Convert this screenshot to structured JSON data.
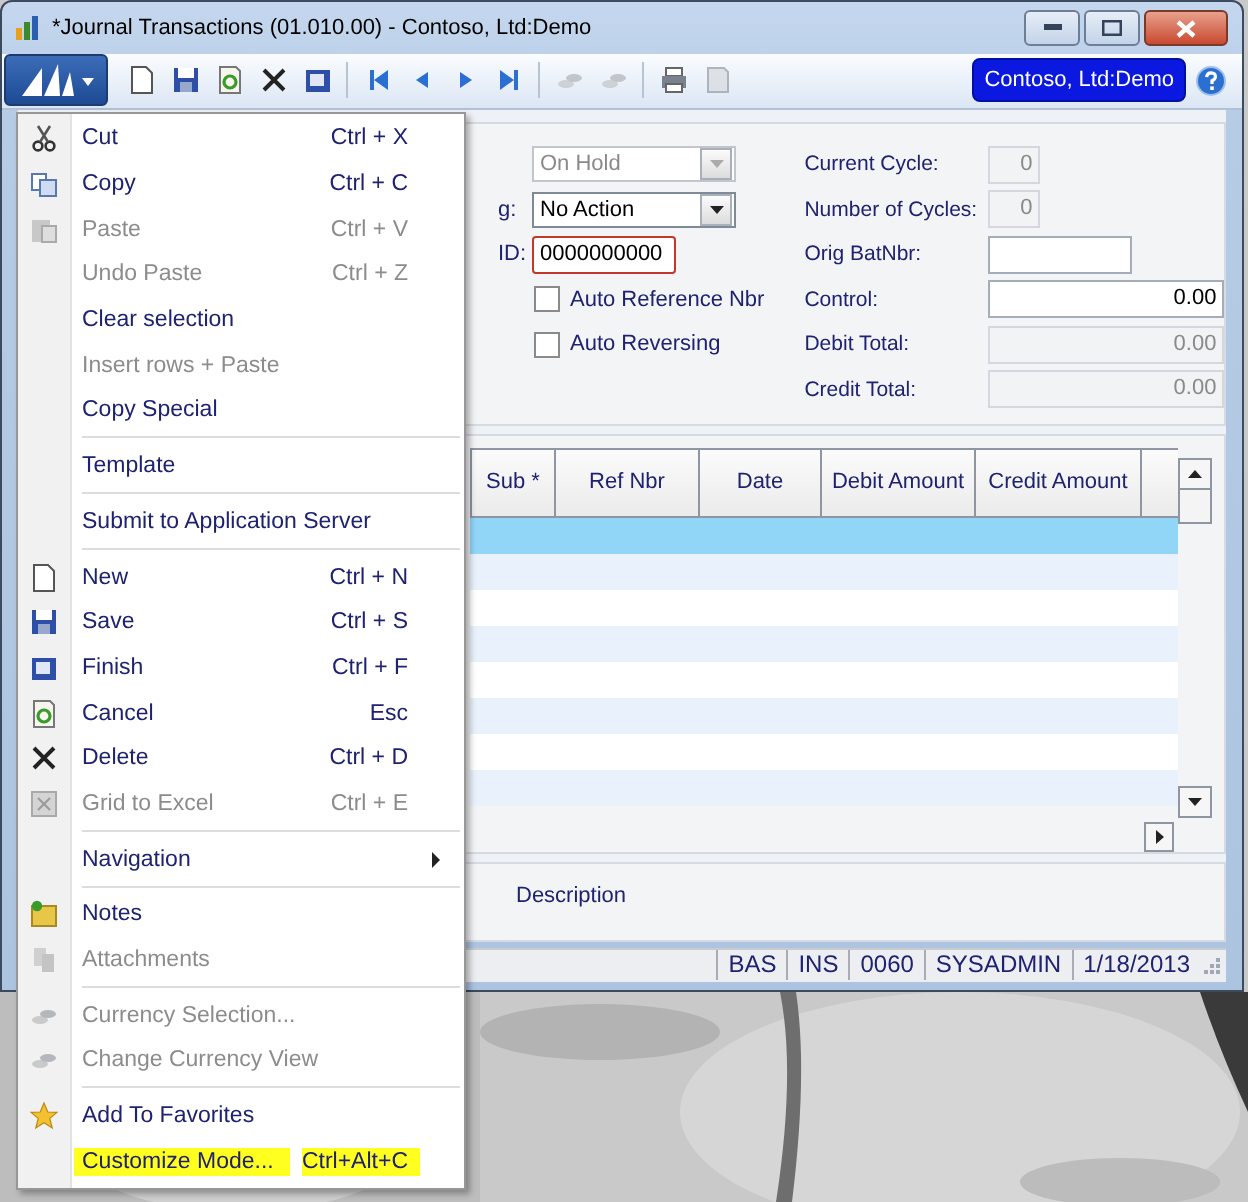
{
  "window": {
    "title": "*Journal Transactions (01.010.00) - Contoso, Ltd:Demo"
  },
  "toolbar": {
    "buttons": [
      {
        "disabled": false
      },
      {
        "disabled": false
      },
      {
        "disabled": false
      },
      {
        "disabled": false
      },
      {
        "disabled": false
      },
      {
        "disabled": false
      },
      {
        "disabled": false
      },
      {
        "disabled": false
      },
      {
        "disabled": false
      },
      {
        "disabled": true
      },
      {
        "disabled": true
      },
      {
        "disabled": false
      },
      {
        "disabled": true
      }
    ],
    "company": "Contoso, Ltd:Demo"
  },
  "form": {
    "left": [
      {
        "kind": "select",
        "value": "On Hold",
        "disabled": true
      },
      {
        "kind": "select",
        "label": "g:",
        "value": "No Action",
        "disabled": false
      },
      {
        "kind": "text",
        "label": "ID:",
        "value": "0000000000",
        "error": true
      },
      {
        "kind": "checkbox",
        "label": "Auto Reference Nbr",
        "checked": false
      },
      {
        "kind": "checkbox",
        "label": "Auto Reversing",
        "checked": false
      }
    ],
    "right": [
      {
        "kind": "short",
        "label": "Current Cycle:",
        "value": "0",
        "disabled": true
      },
      {
        "kind": "short",
        "label": "Number of Cycles:",
        "value": "0",
        "disabled": true
      },
      {
        "kind": "medium",
        "label": "Orig BatNbr:",
        "disabled": false
      },
      {
        "kind": "long",
        "label": "Control:",
        "value": "0.00",
        "disabled": false
      },
      {
        "kind": "long",
        "label": "Debit Total:",
        "value": "0.00",
        "disabled": true
      },
      {
        "kind": "long",
        "label": "Credit Total:",
        "value": "0.00",
        "disabled": true
      }
    ]
  },
  "table": {
    "columns": [
      "Sub *",
      "Ref Nbr",
      "Date",
      "Debit Amount",
      "Credit Amount"
    ],
    "rows": [
      {
        "selected": true
      },
      {
        "selected": false
      },
      {
        "selected": false
      },
      {
        "selected": false
      },
      {
        "selected": false
      },
      {
        "selected": false
      },
      {
        "selected": false
      },
      {
        "selected": false
      }
    ]
  },
  "description_label": "Description",
  "status_bar": [
    "BAS",
    "INS",
    "0060",
    "SYSADMIN",
    "1/18/2013"
  ],
  "menu": {
    "groups": [
      {
        "items": [
          {
            "label": "Cut",
            "shortcut": "Ctrl + X",
            "disabled": false,
            "highlighted": false,
            "submenu": false
          },
          {
            "label": "Copy",
            "shortcut": "Ctrl + C",
            "disabled": false,
            "highlighted": false,
            "submenu": false
          },
          {
            "label": "Paste",
            "shortcut": "Ctrl + V",
            "disabled": true,
            "highlighted": false,
            "submenu": false
          },
          {
            "label": "Undo Paste",
            "shortcut": "Ctrl + Z",
            "disabled": true,
            "highlighted": false,
            "submenu": false
          },
          {
            "label": "Clear selection",
            "disabled": false,
            "highlighted": false,
            "submenu": false
          },
          {
            "label": "Insert rows + Paste",
            "disabled": true,
            "highlighted": false,
            "submenu": false
          },
          {
            "label": "Copy Special",
            "disabled": false,
            "highlighted": false,
            "submenu": false
          }
        ]
      },
      {
        "items": [
          {
            "label": "Template",
            "disabled": false,
            "highlighted": false,
            "submenu": false
          }
        ]
      },
      {
        "items": [
          {
            "label": "Submit to Application Server",
            "disabled": false,
            "highlighted": false,
            "submenu": false
          }
        ]
      },
      {
        "items": [
          {
            "label": "New",
            "shortcut": "Ctrl + N",
            "disabled": false,
            "highlighted": false,
            "submenu": false
          },
          {
            "label": "Save",
            "shortcut": "Ctrl + S",
            "disabled": false,
            "highlighted": false,
            "submenu": false
          },
          {
            "label": "Finish",
            "shortcut": "Ctrl + F",
            "disabled": false,
            "highlighted": false,
            "submenu": false
          },
          {
            "label": "Cancel",
            "shortcut": "Esc",
            "disabled": false,
            "highlighted": false,
            "submenu": false
          },
          {
            "label": "Delete",
            "shortcut": "Ctrl + D",
            "disabled": false,
            "highlighted": false,
            "submenu": false
          },
          {
            "label": "Grid to Excel",
            "shortcut": "Ctrl + E",
            "disabled": true,
            "highlighted": false,
            "submenu": false
          }
        ]
      },
      {
        "items": [
          {
            "label": "Navigation",
            "disabled": false,
            "highlighted": false,
            "submenu": true
          }
        ]
      },
      {
        "items": [
          {
            "label": "Notes",
            "disabled": false,
            "highlighted": false,
            "submenu": false
          },
          {
            "label": "Attachments",
            "disabled": true,
            "highlighted": false,
            "submenu": false
          }
        ]
      },
      {
        "items": [
          {
            "label": "Currency Selection...",
            "disabled": true,
            "highlighted": false,
            "submenu": false
          },
          {
            "label": "Change Currency View",
            "disabled": true,
            "highlighted": false,
            "submenu": false
          }
        ]
      },
      {
        "items": [
          {
            "label": "Add To Favorites",
            "disabled": false,
            "highlighted": false,
            "submenu": false
          },
          {
            "label": "Customize Mode...",
            "shortcut": "Ctrl+Alt+C",
            "disabled": false,
            "highlighted": true,
            "submenu": false
          }
        ]
      }
    ]
  }
}
